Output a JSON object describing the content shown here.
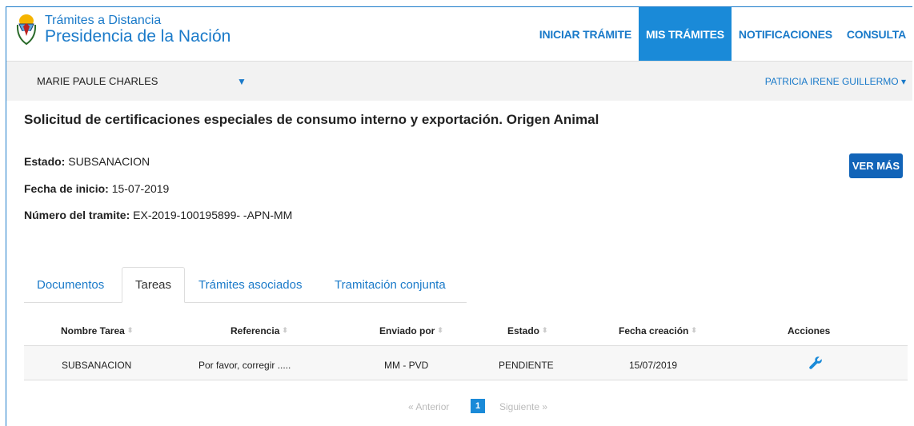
{
  "header": {
    "brand_small": "Trámites a Distancia",
    "brand_big": "Presidencia de la Nación",
    "nav": [
      {
        "label": "INICIAR TRÁMITE",
        "active": false
      },
      {
        "label": "MIS TRÁMITES",
        "active": true
      },
      {
        "label": "NOTIFICACIONES",
        "active": false
      },
      {
        "label": "CONSULTA",
        "active": false
      }
    ]
  },
  "userbar": {
    "represented": "MARIE PAULE CHARLES",
    "caret": "▼",
    "user": "PATRICIA IRENE GUILLERMO ▾"
  },
  "main": {
    "title": "Solicitud de certificaciones especiales de consumo interno y exportación. Origen Animal",
    "estado_label": "Estado:",
    "estado_value": " SUBSANACION",
    "fecha_label": "Fecha de inicio:",
    "fecha_value": " 15-07-2019",
    "numero_label": "Número del tramite:",
    "numero_value": " EX-2019-100195899- -APN-MM",
    "ver_mas": "VER MÁS"
  },
  "tabs": [
    "Documentos",
    "Tareas",
    "Trámites asociados",
    "Tramitación conjunta"
  ],
  "table": {
    "headers": [
      "Nombre Tarea",
      "Referencia",
      "Enviado por",
      "Estado",
      "Fecha creación",
      "Acciones"
    ],
    "rows": [
      [
        "SUBSANACION",
        "Por favor, corregir .....",
        "MM - PVD",
        "PENDIENTE",
        "15/07/2019"
      ]
    ],
    "sort_icon": "⬍"
  },
  "pager": {
    "prev": "« Anterior",
    "current": "1",
    "next": "Siguiente »"
  },
  "colors": {
    "accent": "#1a8ad8",
    "link": "#1a7ac9",
    "button": "#1264b8"
  }
}
